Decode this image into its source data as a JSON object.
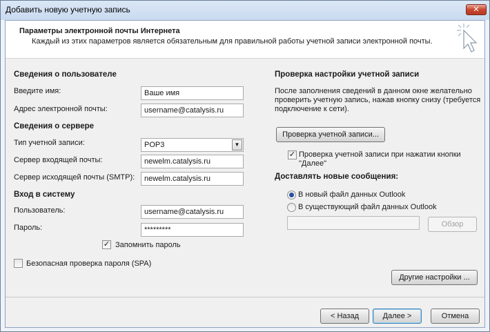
{
  "window": {
    "title": "Добавить новую учетную запись",
    "close_label": "✕"
  },
  "header": {
    "title": "Параметры электронной почты Интернета",
    "subtitle": "Каждый из этих параметров является обязательным для правильной работы учетной записи электронной почты."
  },
  "user_info": {
    "heading": "Сведения о пользователе",
    "name_label": "Введите имя:",
    "name_value": "Ваше имя",
    "email_label": "Адрес электронной почты:",
    "email_value": "username@catalysis.ru"
  },
  "server_info": {
    "heading": "Сведения о сервере",
    "account_type_label": "Тип учетной записи:",
    "account_type_value": "POP3",
    "incoming_label": "Сервер входящей почты:",
    "incoming_value": "newelm.catalysis.ru",
    "outgoing_label": "Сервер исходящей почты (SMTP):",
    "outgoing_value": "newelm.catalysis.ru"
  },
  "login": {
    "heading": "Вход в систему",
    "user_label": "Пользователь:",
    "user_value": "username@catalysis.ru",
    "password_label": "Пароль:",
    "password_value": "*********",
    "remember_label": "Запомнить пароль",
    "remember_checked": true,
    "spa_label": "Безопасная проверка пароля (SPA)",
    "spa_checked": false
  },
  "test": {
    "heading": "Проверка настройки учетной записи",
    "description": "После заполнения сведений в данном окне желательно проверить учетную запись, нажав кнопку снизу (требуется подключение к сети).",
    "button_label": "Проверка учетной записи...",
    "auto_label": "Проверка учетной записи при нажатии кнопки \"Далее\"",
    "auto_checked": true
  },
  "deliver": {
    "heading": "Доставлять новые сообщения:",
    "option_new": "В новый файл данных Outlook",
    "option_existing": "В существующий файл данных Outlook",
    "selected": "new",
    "path_value": "",
    "browse_label": "Обзор"
  },
  "more_settings_label": "Другие настройки ...",
  "footer": {
    "back_label": "< Назад",
    "next_label": "Далее >",
    "cancel_label": "Отмена"
  },
  "check_glyph": "✓"
}
